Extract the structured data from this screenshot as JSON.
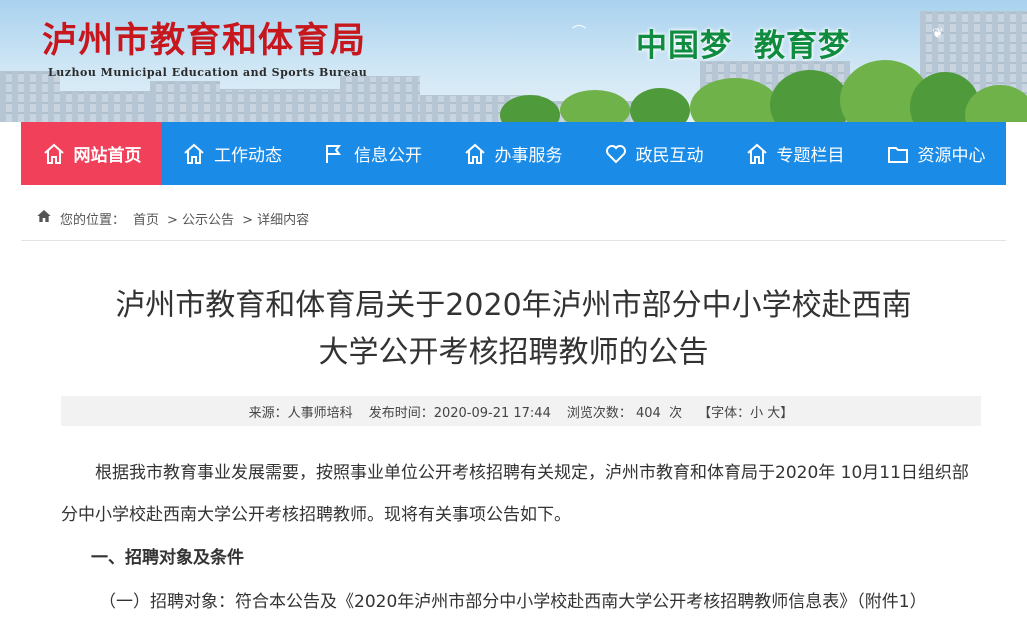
{
  "header": {
    "title_cn": "泸州市教育和体育局",
    "title_en": "Luzhou Municipal Education and Sports Bureau",
    "slogan_1": "中国梦",
    "slogan_2": "教育梦"
  },
  "nav": {
    "items": [
      {
        "label": "网站首页",
        "icon": "home-icon",
        "active": true
      },
      {
        "label": "工作动态",
        "icon": "home-icon"
      },
      {
        "label": "信息公开",
        "icon": "flag-icon"
      },
      {
        "label": "办事服务",
        "icon": "home-icon"
      },
      {
        "label": "政民互动",
        "icon": "heart-icon"
      },
      {
        "label": "专题栏目",
        "icon": "home-icon"
      },
      {
        "label": "资源中心",
        "icon": "folder-icon"
      }
    ]
  },
  "breadcrumb": {
    "prefix": "您的位置：",
    "items": [
      "首页",
      "> 公示公告",
      "> 详细内容"
    ]
  },
  "article": {
    "title_line1": "泸州市教育和体育局关于2020年泸州市部分中小学校赴西南",
    "title_line2": "大学公开考核招聘教师的公告",
    "meta": {
      "source": "来源：人事师培科",
      "published": "发布时间：2020-09-21 17:44",
      "views_label": "浏览次数：",
      "views": "404",
      "views_unit": "次",
      "font_label": "【字体：",
      "font_small": "小",
      "font_large": "大",
      "font_end": "】"
    },
    "paragraph1": "根据我市教育事业发展需要，按照事业单位公开考核招聘有关规定，泸州市教育和体育局于2020年 10月11日组织部分中小学校赴西南大学公开考核招聘教师。现将有关事项公告如下。",
    "heading1": "一、招聘对象及条件",
    "paragraph2": "（一）招聘对象：符合本公告及《2020年泸州市部分中小学校赴西南大学公开考核招聘教师信息表》（附件1）"
  }
}
